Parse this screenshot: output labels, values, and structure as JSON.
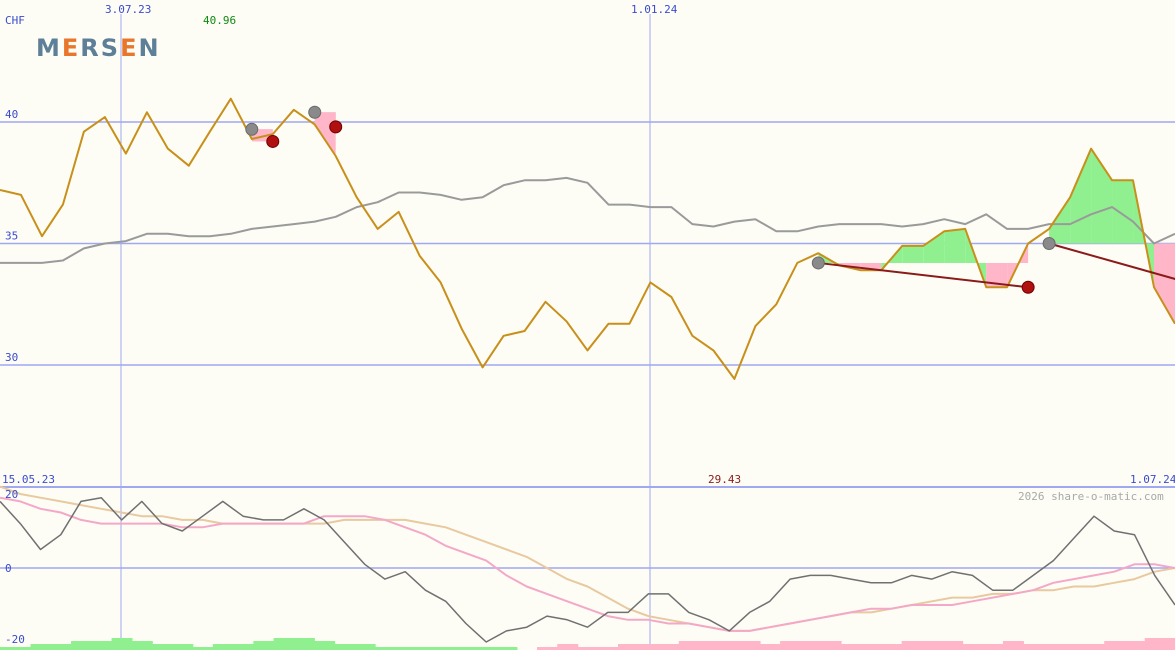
{
  "currency": "CHF",
  "logo": {
    "text": "MERSEN",
    "brand_color": "#5e7f98",
    "accent_color": "#e8762b"
  },
  "labels": {
    "date_mid_top": "3.07.23",
    "date_jan_top": "1.01.24",
    "period_high": "40.96",
    "period_low": "29.43",
    "date_start": "15.05.23",
    "date_end": "1.07.24",
    "watermark": "2026 share-o-matic.com"
  },
  "colors": {
    "price": "#c8901a",
    "moving_average": "#9a9a9a",
    "gain_fill": "#90f090",
    "loss_fill": "#ffb6c8",
    "trend_line": "#8b1a1a",
    "grid": "#a0a8f0",
    "osc_main": "#707070",
    "osc_signal": "#f4a8c8",
    "osc_slow": "#e8c9a0"
  },
  "chart_data": [
    {
      "type": "line",
      "title": "",
      "ylabel": "CHF",
      "y_ticks": [
        30,
        35,
        40
      ],
      "ylim": [
        26.4,
        44.9
      ],
      "x_ticks": [
        "3.07.23",
        "1.01.24"
      ],
      "series": [
        {
          "values": [
            37.2,
            37.0,
            35.3,
            36.6,
            39.6,
            40.2,
            38.7,
            40.4,
            38.9,
            38.2,
            39.6,
            40.96,
            39.3,
            39.5,
            40.5,
            39.9,
            38.6,
            36.9,
            35.6,
            36.3,
            34.5,
            33.4,
            31.5,
            29.9,
            31.2,
            31.4,
            32.6,
            31.8,
            30.6,
            31.7,
            31.7,
            33.4,
            32.8,
            31.2,
            30.6,
            29.43,
            31.6,
            32.5,
            34.2,
            34.6,
            34.1,
            33.9,
            33.9,
            34.9,
            34.9,
            35.5,
            35.6,
            33.2,
            33.2,
            35.0,
            35.6,
            36.9,
            38.9,
            37.6,
            37.6,
            33.2,
            31.7
          ],
          "highlight_name": "price"
        },
        {
          "values": [
            34.2,
            34.2,
            34.2,
            34.3,
            34.8,
            35.0,
            35.1,
            35.4,
            35.4,
            35.3,
            35.3,
            35.4,
            35.6,
            35.7,
            35.8,
            35.9,
            36.1,
            36.5,
            36.7,
            37.1,
            37.1,
            37.0,
            36.8,
            36.9,
            37.4,
            37.6,
            37.6,
            37.7,
            37.5,
            36.6,
            36.6,
            36.5,
            36.5,
            35.8,
            35.7,
            35.9,
            36.0,
            35.5,
            35.5,
            35.7,
            35.8,
            35.8,
            35.8,
            35.7,
            35.8,
            36.0,
            35.8,
            36.2,
            35.6,
            35.6,
            35.8,
            35.8,
            36.2,
            36.5,
            35.9,
            35.0,
            35.4
          ],
          "highlight_name": "moving-average"
        }
      ],
      "signals": [
        {
          "index": 12,
          "value": 39.7,
          "kind": "entry"
        },
        {
          "index": 13,
          "value": 39.2,
          "kind": "exit"
        },
        {
          "index": 15,
          "value": 40.4,
          "kind": "entry"
        },
        {
          "index": 16,
          "value": 39.8,
          "kind": "exit"
        },
        {
          "index": 39,
          "value": 34.2,
          "kind": "entry"
        },
        {
          "index": 49,
          "value": 33.2,
          "kind": "exit"
        },
        {
          "index": 50,
          "value": 35.0,
          "kind": "entry"
        },
        {
          "index": 57,
          "value": 33.3,
          "kind": "exit"
        }
      ],
      "trend_lines": [
        {
          "from_index": 39,
          "from_value": 34.2,
          "to_index": 49,
          "to_value": 33.2
        },
        {
          "from_index": 50,
          "from_value": 35.0,
          "to_index": 57,
          "to_value": 33.3
        }
      ],
      "grid": true
    },
    {
      "type": "line",
      "title": "",
      "y_ticks": [
        -20,
        0,
        20
      ],
      "ylim": [
        -22,
        22
      ],
      "series": [
        {
          "values": [
            18,
            12,
            5,
            9,
            18,
            19,
            13,
            18,
            12,
            10,
            14,
            18,
            14,
            13,
            13,
            16,
            13,
            7,
            1,
            -3,
            -1,
            -6,
            -9,
            -15,
            -20,
            -17,
            -16,
            -13,
            -14,
            -16,
            -12,
            -12,
            -7,
            -7,
            -12,
            -14,
            -17,
            -12,
            -9,
            -3,
            -2,
            -2,
            -3,
            -4,
            -4,
            -2,
            -3,
            -1,
            -2,
            -6,
            -6,
            -2,
            2,
            8,
            14,
            10,
            9,
            -2,
            -10
          ],
          "highlight_name": "oscillator"
        },
        {
          "values": [
            19,
            18,
            16,
            15,
            13,
            12,
            12,
            12,
            12,
            11,
            11,
            12,
            12,
            12,
            12,
            12,
            14,
            14,
            14,
            13,
            11,
            9,
            6,
            4,
            2,
            -2,
            -5,
            -7,
            -9,
            -11,
            -13,
            -14,
            -14,
            -15,
            -15,
            -16,
            -17,
            -17,
            -16,
            -15,
            -14,
            -13,
            -12,
            -11,
            -11,
            -10,
            -10,
            -10,
            -9,
            -8,
            -7,
            -6,
            -4,
            -3,
            -2,
            -1,
            1,
            1,
            0
          ],
          "highlight_name": "signal"
        },
        {
          "values": [
            22,
            20,
            19,
            18,
            17,
            16,
            15,
            14,
            14,
            13,
            13,
            12,
            12,
            12,
            12,
            12,
            12,
            13,
            13,
            13,
            13,
            12,
            11,
            9,
            7,
            5,
            3,
            0,
            -3,
            -5,
            -8,
            -11,
            -13,
            -14,
            -15,
            -16,
            -17,
            -17,
            -16,
            -15,
            -14,
            -13,
            -12,
            -12,
            -11,
            -10,
            -9,
            -8,
            -8,
            -7,
            -7,
            -6,
            -6,
            -5,
            -5,
            -4,
            -3,
            -1,
            0
          ],
          "highlight_name": "slow-signal"
        }
      ],
      "histogram": [
        1,
        1,
        2,
        2,
        3,
        3,
        4,
        3,
        2,
        2,
        1,
        2,
        2,
        3,
        4,
        4,
        3,
        2,
        2,
        1,
        1,
        1,
        1,
        1,
        1,
        1,
        0,
        -1,
        -2,
        -1,
        -1,
        -2,
        -2,
        -2,
        -3,
        -3,
        -3,
        -3,
        -2,
        -3,
        -3,
        -3,
        -2,
        -2,
        -2,
        -3,
        -3,
        -3,
        -2,
        -2,
        -3,
        -2,
        -2,
        -2,
        -2,
        -3,
        -3,
        -4,
        -4
      ],
      "grid": true
    }
  ]
}
